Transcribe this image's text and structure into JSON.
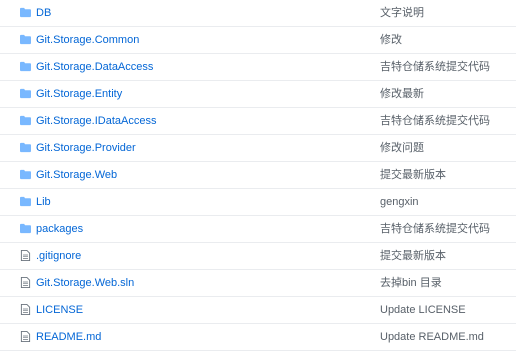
{
  "colors": {
    "link": "#0366d6",
    "message": "#586069",
    "folder_icon": "#79b8ff",
    "file_icon": "#6a737d",
    "row_border": "#eaecef"
  },
  "files": [
    {
      "name": "DB",
      "type": "folder",
      "icon": "folder-icon",
      "message": "文字说明"
    },
    {
      "name": "Git.Storage.Common",
      "type": "folder",
      "icon": "folder-icon",
      "message": "修改"
    },
    {
      "name": "Git.Storage.DataAccess",
      "type": "folder",
      "icon": "folder-icon",
      "message": "吉特仓储系统提交代码"
    },
    {
      "name": "Git.Storage.Entity",
      "type": "folder",
      "icon": "folder-icon",
      "message": "修改最新"
    },
    {
      "name": "Git.Storage.IDataAccess",
      "type": "folder",
      "icon": "folder-icon",
      "message": "吉特仓储系统提交代码"
    },
    {
      "name": "Git.Storage.Provider",
      "type": "folder",
      "icon": "folder-icon",
      "message": "修改问题"
    },
    {
      "name": "Git.Storage.Web",
      "type": "folder",
      "icon": "folder-icon",
      "message": "提交最新版本"
    },
    {
      "name": "Lib",
      "type": "folder",
      "icon": "folder-icon",
      "message": "gengxin"
    },
    {
      "name": "packages",
      "type": "folder",
      "icon": "folder-icon",
      "message": "吉特仓储系统提交代码"
    },
    {
      "name": ".gitignore",
      "type": "file",
      "icon": "file-icon",
      "message": "提交最新版本"
    },
    {
      "name": "Git.Storage.Web.sln",
      "type": "file",
      "icon": "file-icon",
      "message": "去掉bin 目录"
    },
    {
      "name": "LICENSE",
      "type": "file",
      "icon": "file-icon",
      "message": "Update LICENSE"
    },
    {
      "name": "README.md",
      "type": "file",
      "icon": "file-icon",
      "message": "Update README.md"
    }
  ]
}
